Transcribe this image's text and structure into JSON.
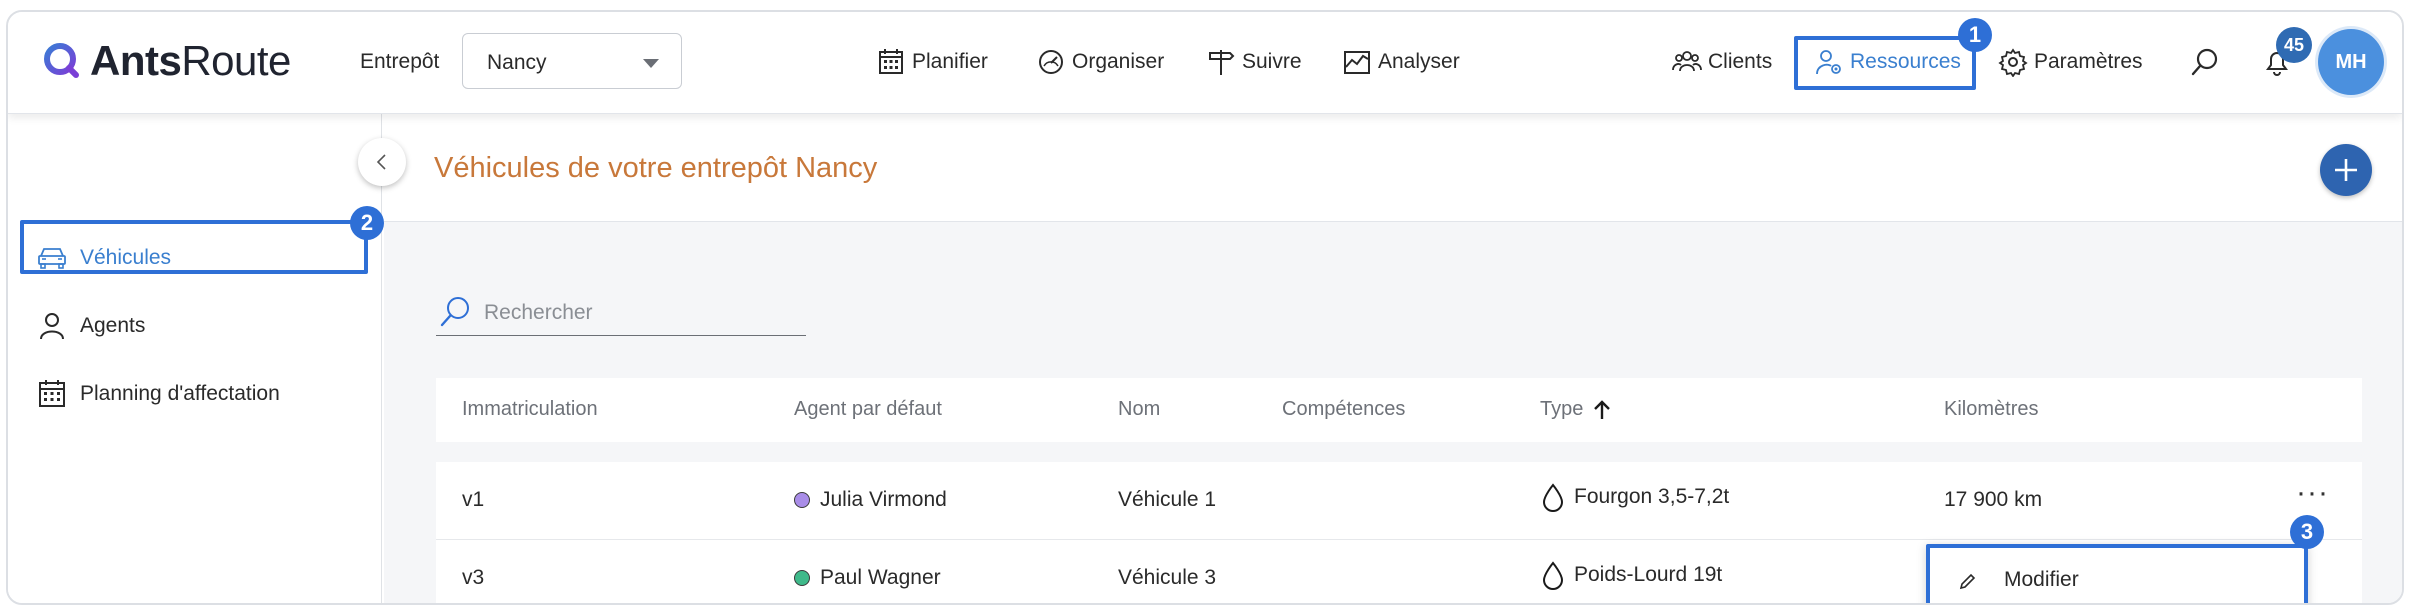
{
  "app": {
    "logo_bold": "Ants",
    "logo_light": "Route"
  },
  "header": {
    "entrepot_label": "Entrepôt",
    "entrepot_value": "Nancy",
    "nav": [
      {
        "label": "Planifier",
        "icon": "calendar-icon"
      },
      {
        "label": "Organiser",
        "icon": "speedometer-icon"
      },
      {
        "label": "Suivre",
        "icon": "signpost-icon"
      },
      {
        "label": "Analyser",
        "icon": "chart-icon"
      }
    ],
    "right_nav": [
      {
        "label": "Clients",
        "icon": "people-icon"
      },
      {
        "label": "Ressources",
        "icon": "user-gear-icon",
        "active": true
      },
      {
        "label": "Paramètres",
        "icon": "gear-icon"
      }
    ],
    "notification_count": "45",
    "avatar_initials": "MH"
  },
  "callouts": [
    "1",
    "2",
    "3"
  ],
  "sidebar": {
    "items": [
      {
        "label": "Véhicules",
        "icon": "car-icon",
        "active": true
      },
      {
        "label": "Agents",
        "icon": "person-icon"
      },
      {
        "label": "Planning d'affectation",
        "icon": "calendar-icon"
      }
    ]
  },
  "main": {
    "title": "Véhicules de votre entrepôt Nancy",
    "search_placeholder": "Rechercher",
    "columns": [
      "Immatriculation",
      "Agent par défaut",
      "Nom",
      "Compétences",
      "Type",
      "Kilomètres"
    ],
    "rows": [
      {
        "immat": "v1",
        "agent": "Julia Virmond",
        "agent_color": "#a98de8",
        "nom": "Véhicule 1",
        "competences": "",
        "type": "Fourgon 3,5-7,2t",
        "km": "17 900 km"
      },
      {
        "immat": "v3",
        "agent": "Paul Wagner",
        "agent_color": "#3fb98a",
        "nom": "Véhicule 3",
        "competences": "",
        "type": "Poids-Lourd 19t",
        "km": ""
      }
    ],
    "menu": {
      "modify_label": "Modifier"
    }
  },
  "colors": {
    "accent": "#2e6fd6",
    "title": "#c8783a",
    "active_link": "#3a7fcf"
  }
}
